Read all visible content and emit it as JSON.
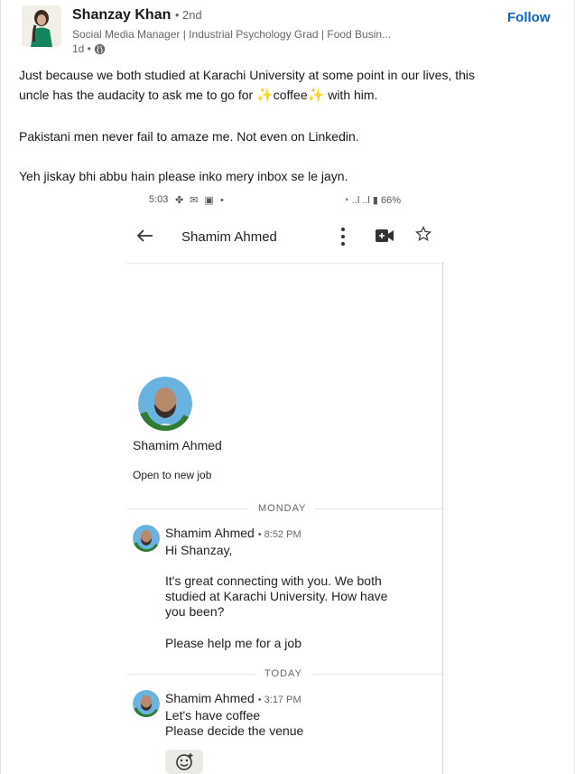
{
  "post": {
    "author_name": "Shanzay Khan",
    "degree": "• 2nd",
    "headline": "Social Media Manager | Industrial Psychology Grad | Food Busin...",
    "time_ago": "1d •",
    "follow_label": "Follow",
    "text_line1_pre": "Just because we both studied at Karachi University at some point in our lives, this",
    "text_line2_pre": "uncle has the audacity to ask me to go for ",
    "text_line2_word": "coffee",
    "text_line2_post": " with him.",
    "text_line3": "Pakistani men never fail to amaze me. Not even on Linkedin.",
    "text_line4": "Yeh jiskay bhi abbu hain please inko mery inbox se le jayn."
  },
  "screenshot": {
    "status_time": "5:03",
    "status_battery": "66%",
    "chat_title": "Shamim Ahmed",
    "profile_name": "Shamim Ahmed",
    "profile_status": "Open to new job",
    "badge_text": "#OPENTOWORK",
    "day1": "MONDAY",
    "day2": "TODAY",
    "msg1": {
      "sender": "Shamim Ahmed",
      "time": "8:52 PM",
      "lines": [
        "Hi Shanzay,",
        "It's great connecting with you. We both",
        "studied at Karachi University. How have",
        "you been?",
        "Please help me for a job"
      ]
    },
    "msg2": {
      "sender": "Shamim Ahmed",
      "time": "3:17 PM",
      "lines": [
        "Let's have coffee",
        "Please decide the venue"
      ]
    }
  },
  "icons": [
    "globe-icon",
    "back-arrow-icon",
    "more-vert-icon",
    "video-call-icon",
    "star-icon",
    "add-reaction-icon",
    "sparkles-icon"
  ]
}
